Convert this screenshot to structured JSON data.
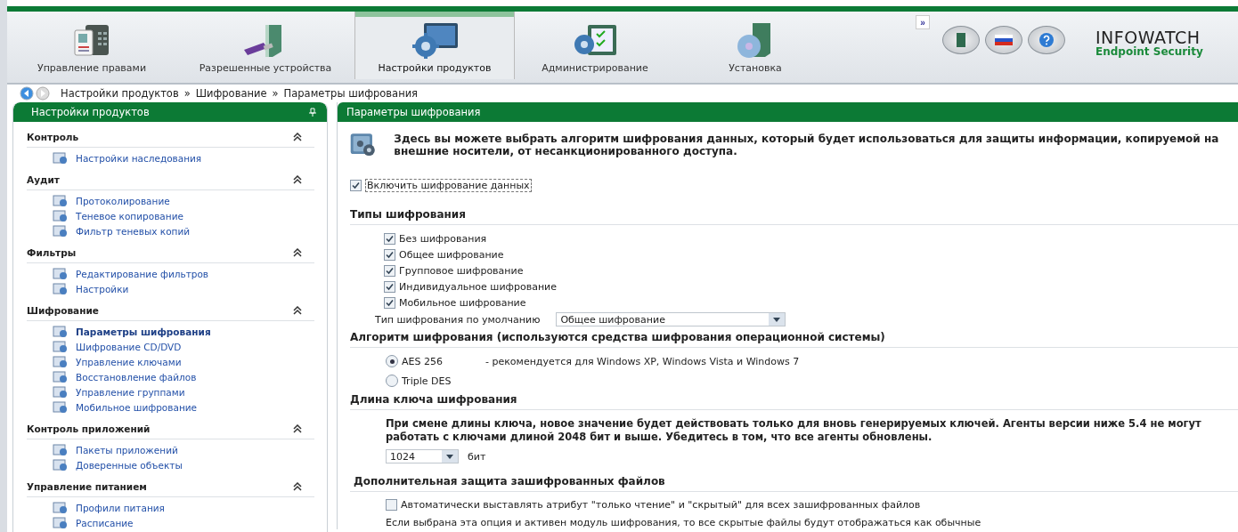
{
  "tabs": [
    {
      "label": "Управление правами",
      "selected": false
    },
    {
      "label": "Разрешенные устройства",
      "selected": false
    },
    {
      "label": "Настройки продуктов",
      "selected": true
    },
    {
      "label": "Администрирование",
      "selected": false
    },
    {
      "label": "Установка",
      "selected": false
    }
  ],
  "more_button": "»",
  "logo": {
    "title": "INFOWATCH",
    "subtitle": "Endpoint Security"
  },
  "breadcrumb": {
    "items": [
      "Настройки продуктов",
      "Шифрование",
      "Параметры шифрования"
    ],
    "separator": "»"
  },
  "sidebar": {
    "title": "Настройки продуктов",
    "sections": [
      {
        "title": "Контроль",
        "expanded": true,
        "items": [
          {
            "label": "Настройки наследования",
            "selected": false
          }
        ]
      },
      {
        "title": "Аудит",
        "expanded": true,
        "items": [
          {
            "label": "Протоколирование",
            "selected": false
          },
          {
            "label": "Теневое копирование",
            "selected": false
          },
          {
            "label": "Фильтр теневых копий",
            "selected": false
          }
        ]
      },
      {
        "title": "Фильтры",
        "expanded": true,
        "items": [
          {
            "label": "Редактирование фильтров",
            "selected": false
          },
          {
            "label": "Настройки",
            "selected": false
          }
        ]
      },
      {
        "title": "Шифрование",
        "expanded": true,
        "items": [
          {
            "label": "Параметры шифрования",
            "selected": true
          },
          {
            "label": "Шифрование CD/DVD",
            "selected": false
          },
          {
            "label": "Управление ключами",
            "selected": false
          },
          {
            "label": "Восстановление файлов",
            "selected": false
          },
          {
            "label": "Управление группами",
            "selected": false
          },
          {
            "label": "Мобильное шифрование",
            "selected": false
          }
        ]
      },
      {
        "title": "Контроль приложений",
        "expanded": true,
        "items": [
          {
            "label": "Пакеты приложений",
            "selected": false
          },
          {
            "label": "Доверенные объекты",
            "selected": false
          }
        ]
      },
      {
        "title": "Управление питанием",
        "expanded": true,
        "items": [
          {
            "label": "Профили питания",
            "selected": false
          },
          {
            "label": "Расписание",
            "selected": false
          }
        ]
      }
    ]
  },
  "content": {
    "title": "Параметры шифрования",
    "intro": "Здесь вы можете выбрать алгоритм шифрования данных, который будет использоваться для защиты информации, копируемой на внешние носители, от несанкционированного доступа.",
    "enable": {
      "label": "Включить шифрование данных",
      "checked": true
    },
    "types": {
      "heading": "Типы шифрования",
      "options": [
        {
          "label": "Без шифрования",
          "checked": true
        },
        {
          "label": "Общее шифрование",
          "checked": true
        },
        {
          "label": "Групповое шифрование",
          "checked": true
        },
        {
          "label": "Индивидуальное шифрование",
          "checked": true
        },
        {
          "label": "Мобильное шифрование",
          "checked": true
        }
      ],
      "default_label": "Тип шифрования по умолчанию",
      "default_value": "Общее шифрование"
    },
    "algorithm": {
      "heading": "Алгоритм шифрования (используются средства шифрования операционной системы)",
      "options": [
        {
          "label": "AES 256",
          "note": "- рекомендуется для Windows XP, Windows Vista и Windows 7",
          "selected": true
        },
        {
          "label": "Triple DES",
          "selected": false
        }
      ]
    },
    "key_length": {
      "heading": "Длина ключа шифрования",
      "warning": "При смене длины ключа, новое значение будет действовать только для вновь генерируемых ключей. Агенты версии ниже 5.4 не могут работать с ключами длиной 2048 бит и выше. Убедитесь в том, что все агенты обновлены.",
      "value": "1024",
      "unit": "бит"
    },
    "extra": {
      "heading": "Дополнительная защита зашифрованных файлов",
      "option": {
        "label": "Автоматически выставлять атрибут \"только чтение\" и \"скрытый\" для всех зашифрованных файлов",
        "checked": false
      },
      "note": "Если выбрана эта опция и активен модуль шифрования, то все скрытые файлы будут отображаться как обычные"
    }
  }
}
